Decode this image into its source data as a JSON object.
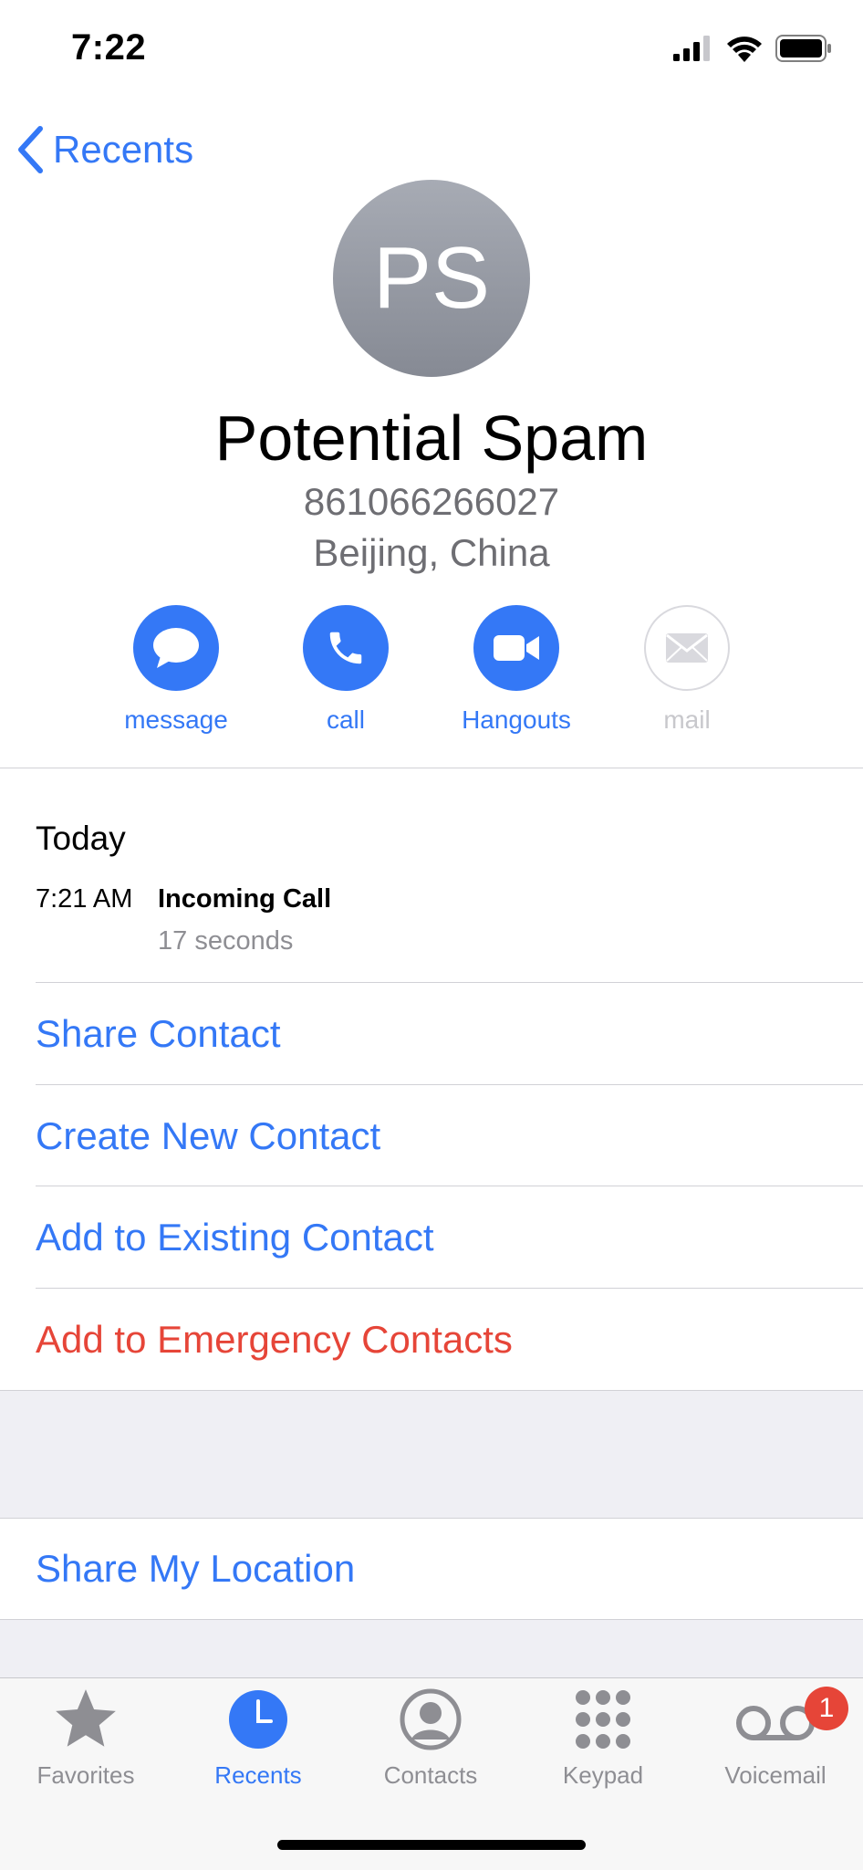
{
  "status_bar": {
    "time": "7:22"
  },
  "nav": {
    "back_label": "Recents"
  },
  "contact": {
    "initials": "PS",
    "name": "Potential Spam",
    "number": "861066266027",
    "location": "Beijing, China"
  },
  "actions": [
    {
      "label": "message",
      "icon": "message-bubble-icon",
      "enabled": true
    },
    {
      "label": "call",
      "icon": "phone-icon",
      "enabled": true
    },
    {
      "label": "Hangouts",
      "icon": "video-camera-icon",
      "enabled": true
    },
    {
      "label": "mail",
      "icon": "envelope-icon",
      "enabled": false
    }
  ],
  "history": {
    "header": "Today",
    "entries": [
      {
        "time": "7:21 AM",
        "type": "Incoming Call",
        "duration": "17 seconds"
      }
    ]
  },
  "options": [
    {
      "label": "Share Contact",
      "style": "blue"
    },
    {
      "label": "Create New Contact",
      "style": "blue"
    },
    {
      "label": "Add to Existing Contact",
      "style": "blue"
    },
    {
      "label": "Add to Emergency Contacts",
      "style": "red"
    }
  ],
  "location_option": {
    "label": "Share My Location"
  },
  "tabs": [
    {
      "label": "Favorites",
      "icon": "star-icon",
      "active": false
    },
    {
      "label": "Recents",
      "icon": "clock-icon",
      "active": true
    },
    {
      "label": "Contacts",
      "icon": "person-circle-icon",
      "active": false
    },
    {
      "label": "Keypad",
      "icon": "keypad-icon",
      "active": false
    },
    {
      "label": "Voicemail",
      "icon": "voicemail-icon",
      "active": false,
      "badge": "1"
    }
  ],
  "colors": {
    "accent": "#3478f6",
    "destructive": "#e64538",
    "secondary_text": "#6e6e73",
    "tab_inactive": "#8e8e93"
  }
}
